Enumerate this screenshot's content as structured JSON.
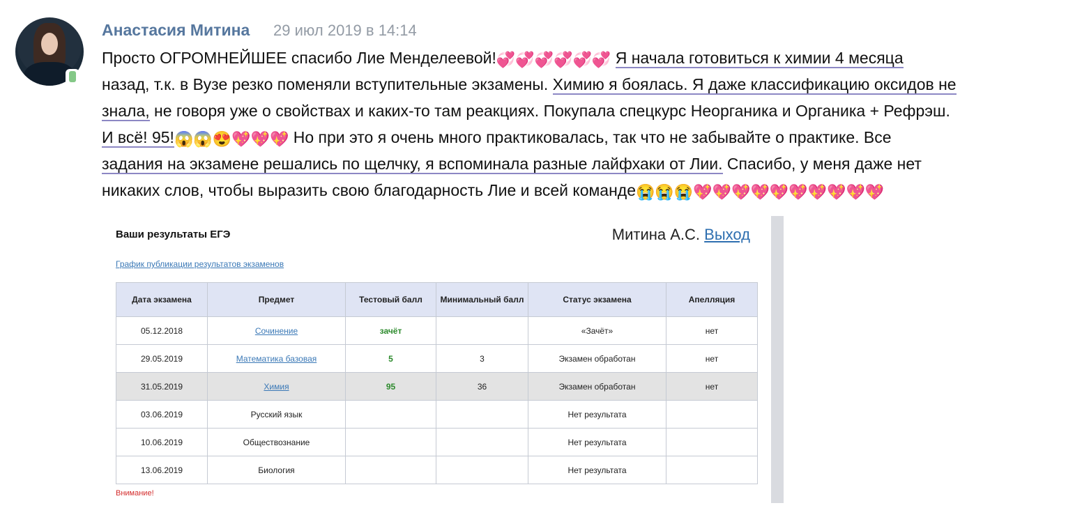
{
  "post": {
    "author": "Анастасия Митина",
    "date": "29 июл 2019 в 14:14",
    "lines": [
      "Просто ОГРОМНЕЙШЕЕ спасибо Лие Менделеевой!",
      "назад, т.к. в Вузе резко поменяли вступительные экзамены.",
      "знала,",
      "И всё! 95!",
      "задания на экзамене решались по щелчку, я вспоминала разные лайфхаки от Лии.",
      "никаких слов, чтобы выразить свою благодарность Лие и всей команде"
    ],
    "frag": {
      "l1_u": "Я начала готовиться к химии 4 месяца",
      "l2_u": "Химию я боялась. Я даже классификацию оксидов не",
      "l3_rest": " не говоря уже о свойствах и каких-то там реакциях. Покупала спецкурс Неорганика и Органика + Рефрэш.",
      "l4_rest": " Но при это я очень много практиковалась, так что не забывайте о практике. Все",
      "l5_rest": " Спасибо, у меня даже нет"
    },
    "emoji": {
      "hearts_two": "💞",
      "heart_sparkle": "💖",
      "scream": "😱",
      "heart_eyes": "😍",
      "sob": "😭"
    }
  },
  "screenshot": {
    "title": "Ваши результаты ЕГЭ",
    "user_name": "Митина А.С.",
    "logout": "Выход",
    "schedule_link": "График публикации результатов экзаменов",
    "headers": [
      "Дата экзамена",
      "Предмет",
      "Тестовый балл",
      "Минимальный балл",
      "Статус экзамена",
      "Апелляция"
    ],
    "rows": [
      {
        "date": "05.12.2018",
        "subject": "Сочинение",
        "score": "зачёт",
        "min": "",
        "status": "«Зачёт»",
        "appeal": "нет"
      },
      {
        "date": "29.05.2019",
        "subject": "Математика базовая",
        "score": "5",
        "min": "3",
        "status": "Экзамен обработан",
        "appeal": "нет"
      },
      {
        "date": "31.05.2019",
        "subject": "Химия",
        "score": "95",
        "min": "36",
        "status": "Экзамен обработан",
        "appeal": "нет"
      },
      {
        "date": "03.06.2019",
        "subject": "Русский язык",
        "score": "",
        "min": "",
        "status": "Нет результата",
        "appeal": ""
      },
      {
        "date": "10.06.2019",
        "subject": "Обществознание",
        "score": "",
        "min": "",
        "status": "Нет результата",
        "appeal": ""
      },
      {
        "date": "13.06.2019",
        "subject": "Биология",
        "score": "",
        "min": "",
        "status": "Нет результата",
        "appeal": ""
      }
    ],
    "warning": "Внимание!"
  }
}
